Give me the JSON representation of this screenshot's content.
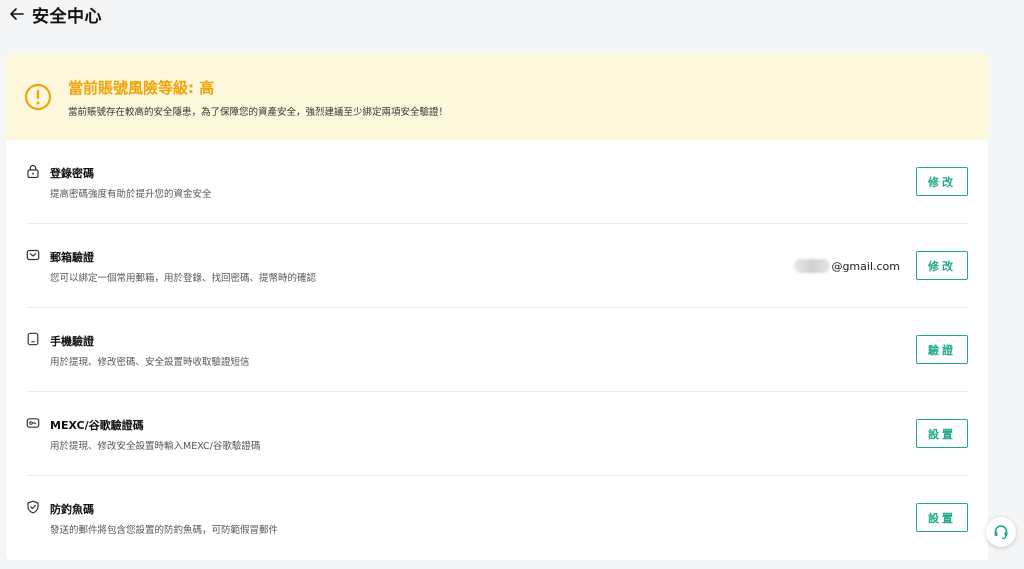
{
  "header": {
    "title": "安全中心"
  },
  "alert": {
    "title": "當前賬號風險等級: 高",
    "description": "當前賬號存在較高的安全隱患，為了保障您的資產安全，強烈建議至少綁定兩項安全驗證！",
    "color": "#f0a30a"
  },
  "items": [
    {
      "id": "password",
      "icon": "lock-icon",
      "title": "登錄密碼",
      "description": "提高密碼強度有助於提升您的資金安全",
      "button": "修改"
    },
    {
      "id": "email",
      "icon": "mail-icon",
      "title": "郵箱驗證",
      "description": "您可以綁定一個常用郵箱，用於登錄、找回密碼、提幣時的確認",
      "value": "@gmail.com",
      "button": "修改"
    },
    {
      "id": "phone",
      "icon": "phone-icon",
      "title": "手機驗證",
      "description": "用於提現、修改密碼、安全設置時收取驗證短信",
      "button": "驗證"
    },
    {
      "id": "authenticator",
      "icon": "key-icon",
      "title": "MEXC/谷歌驗證碼",
      "description": "用於提現、修改安全設置時輸入MEXC/谷歌驗證碼",
      "button": "設置"
    },
    {
      "id": "anti-phishing",
      "icon": "shield-icon",
      "title": "防釣魚碼",
      "description": "發送的郵件將包含您設置的防釣魚碼，可防範假冒郵件",
      "button": "設置"
    }
  ],
  "accent_color": "#1fa98a"
}
